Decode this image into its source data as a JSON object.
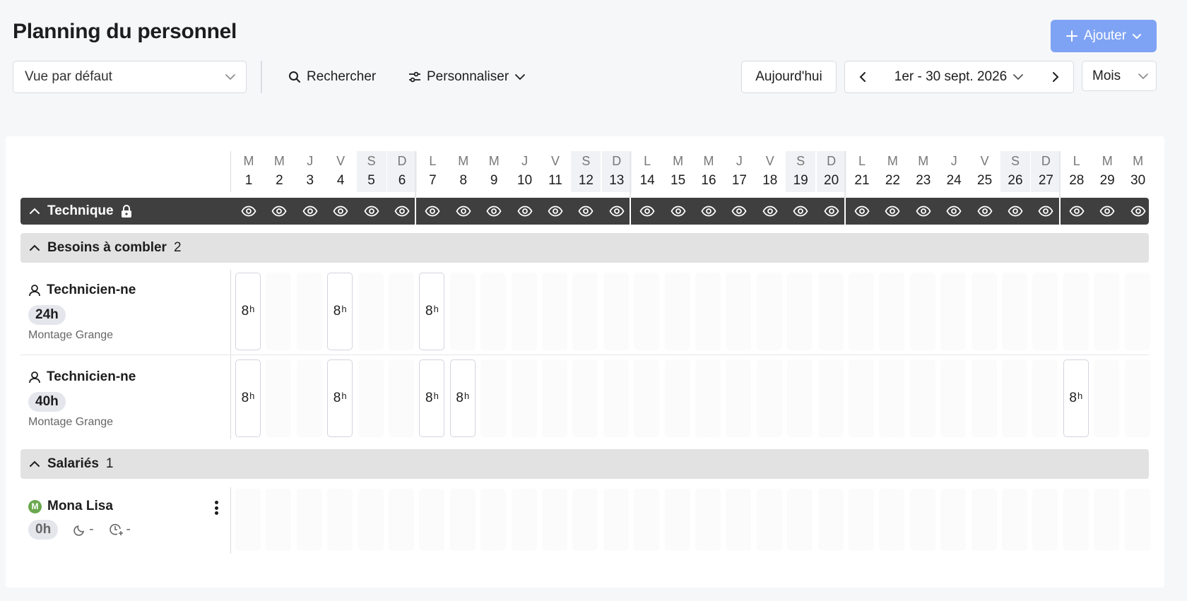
{
  "header": {
    "title": "Planning du personnel",
    "add_label": "Ajouter"
  },
  "toolbar": {
    "view_select": "Vue par défaut",
    "search_label": "Rechercher",
    "customize_label": "Personnaliser",
    "today_label": "Aujourd'hui",
    "range_label": "1er - 30 sept. 2026",
    "mode_select": "Mois"
  },
  "calendar": {
    "days": [
      {
        "letter": "M",
        "num": "1",
        "weekend": false
      },
      {
        "letter": "M",
        "num": "2",
        "weekend": false
      },
      {
        "letter": "J",
        "num": "3",
        "weekend": false
      },
      {
        "letter": "V",
        "num": "4",
        "weekend": false
      },
      {
        "letter": "S",
        "num": "5",
        "weekend": true
      },
      {
        "letter": "D",
        "num": "6",
        "weekend": true
      },
      {
        "letter": "L",
        "num": "7",
        "weekend": false
      },
      {
        "letter": "M",
        "num": "8",
        "weekend": false
      },
      {
        "letter": "M",
        "num": "9",
        "weekend": false
      },
      {
        "letter": "J",
        "num": "10",
        "weekend": false
      },
      {
        "letter": "V",
        "num": "11",
        "weekend": false
      },
      {
        "letter": "S",
        "num": "12",
        "weekend": true
      },
      {
        "letter": "D",
        "num": "13",
        "weekend": true
      },
      {
        "letter": "L",
        "num": "14",
        "weekend": false
      },
      {
        "letter": "M",
        "num": "15",
        "weekend": false
      },
      {
        "letter": "M",
        "num": "16",
        "weekend": false
      },
      {
        "letter": "J",
        "num": "17",
        "weekend": false
      },
      {
        "letter": "V",
        "num": "18",
        "weekend": false
      },
      {
        "letter": "S",
        "num": "19",
        "weekend": true
      },
      {
        "letter": "D",
        "num": "20",
        "weekend": true
      },
      {
        "letter": "L",
        "num": "21",
        "weekend": false
      },
      {
        "letter": "M",
        "num": "22",
        "weekend": false
      },
      {
        "letter": "M",
        "num": "23",
        "weekend": false
      },
      {
        "letter": "J",
        "num": "24",
        "weekend": false
      },
      {
        "letter": "V",
        "num": "25",
        "weekend": false
      },
      {
        "letter": "S",
        "num": "26",
        "weekend": true
      },
      {
        "letter": "D",
        "num": "27",
        "weekend": true
      },
      {
        "letter": "L",
        "num": "28",
        "weekend": false
      },
      {
        "letter": "M",
        "num": "29",
        "weekend": false
      },
      {
        "letter": "M",
        "num": "30",
        "weekend": false
      }
    ]
  },
  "team": {
    "name": "Technique"
  },
  "needs_section": {
    "title": "Besoins à combler",
    "count": "2",
    "rows": [
      {
        "role": "Technicien-ne",
        "hours": "24h",
        "location": "Montage Grange",
        "shifts": [
          {
            "day": 1,
            "value": "8",
            "unit": "h"
          },
          {
            "day": 4,
            "value": "8",
            "unit": "h"
          },
          {
            "day": 7,
            "value": "8",
            "unit": "h"
          }
        ]
      },
      {
        "role": "Technicien-ne",
        "hours": "40h",
        "location": "Montage Grange",
        "shifts": [
          {
            "day": 1,
            "value": "8",
            "unit": "h"
          },
          {
            "day": 4,
            "value": "8",
            "unit": "h"
          },
          {
            "day": 7,
            "value": "8",
            "unit": "h"
          },
          {
            "day": 8,
            "value": "8",
            "unit": "h"
          },
          {
            "day": 28,
            "value": "8",
            "unit": "h"
          }
        ]
      }
    ]
  },
  "employees_section": {
    "title": "Salariés",
    "count": "1",
    "employee": {
      "initial": "M",
      "name": "Mona Lisa",
      "hours": "0h",
      "night_value": "-",
      "overtime_value": "-",
      "avatar_color": "#6aa84f"
    }
  }
}
